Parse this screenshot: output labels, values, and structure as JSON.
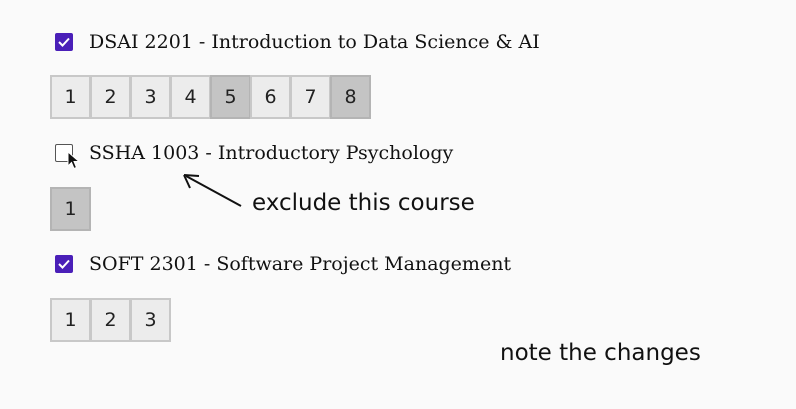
{
  "courses": [
    {
      "checked": true,
      "label": "DSAI 2201 - Introduction to Data Science & AI",
      "sections": [
        {
          "label": "1",
          "selected": false
        },
        {
          "label": "2",
          "selected": false
        },
        {
          "label": "3",
          "selected": false
        },
        {
          "label": "4",
          "selected": false
        },
        {
          "label": "5",
          "selected": true
        },
        {
          "label": "6",
          "selected": false
        },
        {
          "label": "7",
          "selected": false
        },
        {
          "label": "8",
          "selected": true
        }
      ]
    },
    {
      "checked": false,
      "label": "SSHA 1003 - Introductory Psychology",
      "sections": [
        {
          "label": "1",
          "selected": true
        }
      ]
    },
    {
      "checked": true,
      "label": "SOFT 2301 - Software Project Management",
      "sections": [
        {
          "label": "1",
          "selected": false
        },
        {
          "label": "2",
          "selected": false
        },
        {
          "label": "3",
          "selected": false
        }
      ]
    }
  ],
  "annotations": {
    "exclude_note": "exclude this course",
    "changes_note": "note the changes"
  },
  "colors": {
    "checkbox_accent": "#4a1fb8",
    "section_default": "#ececec",
    "section_selected": "#c4c4c4"
  },
  "icons": {
    "cursor": "mouse-pointer-icon",
    "arrow": "annotation-arrow-icon",
    "check": "checkmark-icon"
  }
}
